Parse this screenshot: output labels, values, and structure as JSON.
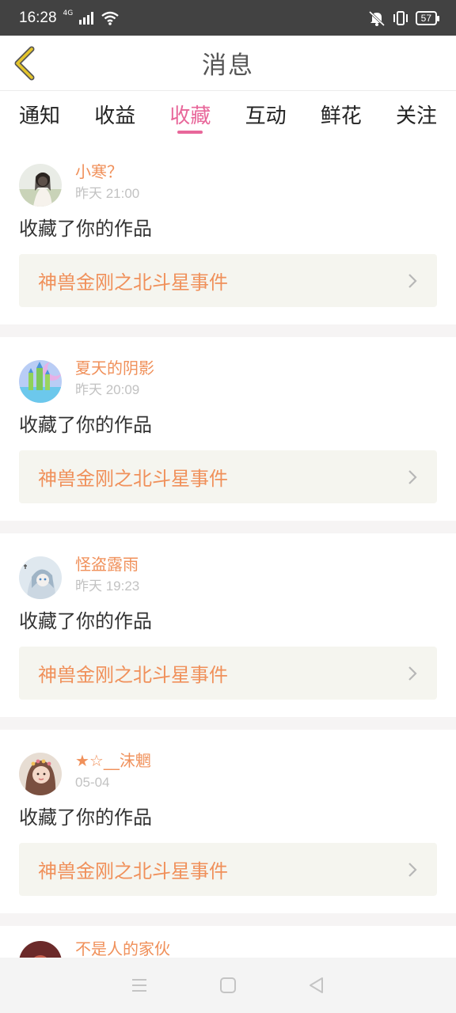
{
  "status_bar": {
    "time": "16:28",
    "network": "4G",
    "battery": "57"
  },
  "header": {
    "title": "消息"
  },
  "tabs": [
    {
      "label": "通知",
      "active": false
    },
    {
      "label": "收益",
      "active": false
    },
    {
      "label": "收藏",
      "active": true
    },
    {
      "label": "互动",
      "active": false
    },
    {
      "label": "鲜花",
      "active": false
    },
    {
      "label": "关注",
      "active": false
    }
  ],
  "items": [
    {
      "username": "小寒？",
      "time": "昨天 21:00",
      "action": "收藏了你的作品",
      "work": "神兽金刚之北斗星事件"
    },
    {
      "username": "夏天的阴影",
      "time": "昨天 20:09",
      "action": "收藏了你的作品",
      "work": "神兽金刚之北斗星事件"
    },
    {
      "username": "怪盗露雨",
      "time": "昨天 19:23",
      "action": "收藏了你的作品",
      "work": "神兽金刚之北斗星事件"
    },
    {
      "username": "★☆__沫魍",
      "time": "05-04",
      "action": "收藏了你的作品",
      "work": "神兽金刚之北斗星事件"
    },
    {
      "username": "不是人的家伙"
    }
  ],
  "colors": {
    "accent": "#e8679a",
    "username": "#f0905a",
    "back_arrow": "#e5c52b"
  },
  "icons": {
    "back": "chevron-left-icon",
    "work_arrow": "chevron-right-icon",
    "nav_menu": "menu-icon",
    "nav_home": "home-square-icon",
    "nav_back": "back-triangle-icon"
  }
}
